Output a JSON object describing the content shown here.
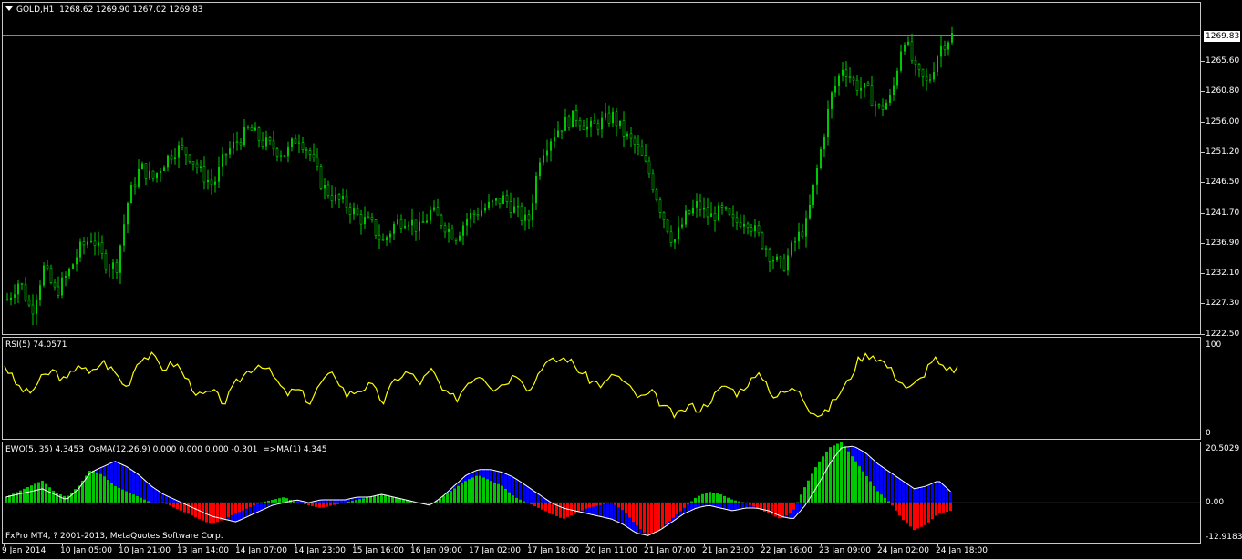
{
  "main": {
    "symbol_title": "GOLD,H1  1268.62 1269.90 1267.02 1269.83",
    "current_price": "1269.83",
    "price_levels": [
      "1265.60",
      "1260.80",
      "1256.00",
      "1251.20",
      "1246.50",
      "1241.70",
      "1236.90",
      "1232.10",
      "1227.30",
      "1222.50"
    ],
    "bull_color": "#00c800",
    "close_path": [
      1228,
      1231,
      1226,
      1233,
      1229,
      1232,
      1236,
      1238,
      1234,
      1233,
      1244,
      1249,
      1247,
      1250,
      1252,
      1251,
      1248,
      1246,
      1251,
      1253,
      1255,
      1253,
      1252,
      1251,
      1254,
      1251,
      1246,
      1244,
      1243,
      1241,
      1240,
      1237,
      1240,
      1241,
      1239,
      1242,
      1240,
      1238,
      1241,
      1242,
      1243,
      1244,
      1242,
      1240,
      1251,
      1254,
      1256,
      1257,
      1255,
      1256,
      1257,
      1254,
      1252,
      1248,
      1242,
      1237,
      1241,
      1243,
      1241,
      1242,
      1240,
      1241,
      1238,
      1235,
      1233,
      1237,
      1240,
      1250,
      1260,
      1265,
      1262,
      1261,
      1258,
      1260,
      1270,
      1264,
      1262,
      1268,
      1269.83
    ]
  },
  "rsi": {
    "title": "RSI(5) 74.0571",
    "levels": [
      "100",
      "0"
    ],
    "color": "#ffff00",
    "values": [
      78,
      55,
      45,
      62,
      72,
      58,
      80,
      66,
      82,
      70,
      52,
      85,
      88,
      74,
      80,
      60,
      42,
      48,
      35,
      58,
      72,
      80,
      65,
      45,
      50,
      36,
      60,
      68,
      44,
      50,
      55,
      36,
      62,
      70,
      58,
      72,
      45,
      40,
      60,
      68,
      52,
      58,
      70,
      48,
      78,
      82,
      86,
      72,
      60,
      55,
      68,
      54,
      40,
      46,
      30,
      20,
      32,
      28,
      42,
      55,
      46,
      60,
      66,
      42,
      48,
      52,
      26,
      20,
      40,
      58,
      86,
      90,
      80,
      65,
      50,
      62,
      86,
      70,
      74
    ]
  },
  "ewo": {
    "title": "EWO(5, 35) 4.3453  OsMA(12,26,9) 0.000 0.000 0.000 -0.301  =>MA(1) 4.345",
    "levels": [
      "20.5029",
      "0.00",
      "-12.9183"
    ],
    "pos_color": "#00c800",
    "neg_color": "#ff0000",
    "ewo_color": "#0000ff",
    "osma_pos": [
      2,
      4,
      6,
      8,
      4,
      2,
      6,
      12,
      10,
      6,
      4,
      2,
      0,
      0,
      -2,
      -4,
      -6,
      -8,
      -6,
      -4,
      -2,
      0,
      1,
      2,
      0,
      -1,
      -2,
      -1,
      0,
      1,
      2,
      3,
      2,
      1,
      0,
      -1,
      2,
      5,
      8,
      10,
      8,
      6,
      2,
      0,
      -2,
      -4,
      -6,
      -4,
      -2,
      -1,
      0,
      -3,
      -8,
      -12,
      -10,
      -6,
      -2,
      2,
      4,
      3,
      1,
      0,
      -2,
      -4,
      -6,
      -3,
      6,
      14,
      20,
      22,
      16,
      10,
      4,
      0,
      -6,
      -10,
      -8,
      -4,
      -3
    ],
    "ewo_line": [
      2,
      3,
      4,
      5,
      3,
      1,
      5,
      11,
      13,
      15,
      13,
      10,
      6,
      3,
      1,
      -1,
      -3,
      -5,
      -6,
      -7,
      -5,
      -3,
      -1,
      0,
      1,
      0,
      1,
      1,
      1,
      2,
      2,
      3,
      2,
      1,
      0,
      -1,
      2,
      6,
      10,
      12,
      12,
      11,
      9,
      6,
      3,
      0,
      -2,
      -3,
      -4,
      -5,
      -6,
      -8,
      -11,
      -12,
      -10,
      -7,
      -4,
      -2,
      -1,
      -2,
      -3,
      -2,
      -2,
      -3,
      -5,
      -6,
      -1,
      6,
      14,
      20,
      20.5,
      18,
      14,
      11,
      8,
      5,
      6,
      8,
      4
    ]
  },
  "xaxis": {
    "labels": [
      "9 Jan 2014",
      "10 Jan 05:00",
      "10 Jan 21:00",
      "13 Jan 14:00",
      "14 Jan 07:00",
      "14 Jan 23:00",
      "15 Jan 16:00",
      "16 Jan 09:00",
      "17 Jan 02:00",
      "17 Jan 18:00",
      "20 Jan 11:00",
      "21 Jan 07:00",
      "21 Jan 23:00",
      "22 Jan 16:00",
      "23 Jan 09:00",
      "24 Jan 02:00",
      "24 Jan 18:00"
    ]
  },
  "copyright": "FxPro MT4, ? 2001-2013, MetaQuotes Software Corp."
}
